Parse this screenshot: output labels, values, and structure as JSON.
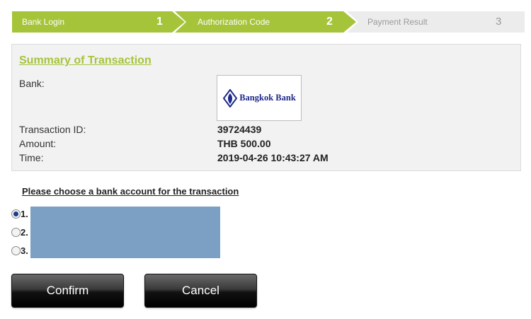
{
  "steps": [
    {
      "label": "Bank Login",
      "number": "1",
      "state": "done"
    },
    {
      "label": "Authorization Code",
      "number": "2",
      "state": "current"
    },
    {
      "label": "Payment Result",
      "number": "3",
      "state": "pending"
    }
  ],
  "colors": {
    "accent": "#a5c43a",
    "redaction": "#7c9fc4",
    "panel": "#f2f2f2"
  },
  "summary": {
    "title": "Summary of Transaction",
    "bank_label": "Bank:",
    "bank_logo_text": "Bangkok Bank",
    "transaction_id_label": "Transaction ID:",
    "transaction_id": "39724439",
    "amount_label": "Amount:",
    "amount": "THB 500.00",
    "time_label": "Time:",
    "time": "2019-04-26 10:43:27 AM"
  },
  "accounts": {
    "title": "Please choose a bank account for the transaction",
    "options": [
      {
        "number": "1.",
        "selected": true
      },
      {
        "number": "2.",
        "selected": false
      },
      {
        "number": "3.",
        "selected": false
      }
    ]
  },
  "buttons": {
    "confirm": "Confirm",
    "cancel": "Cancel"
  }
}
